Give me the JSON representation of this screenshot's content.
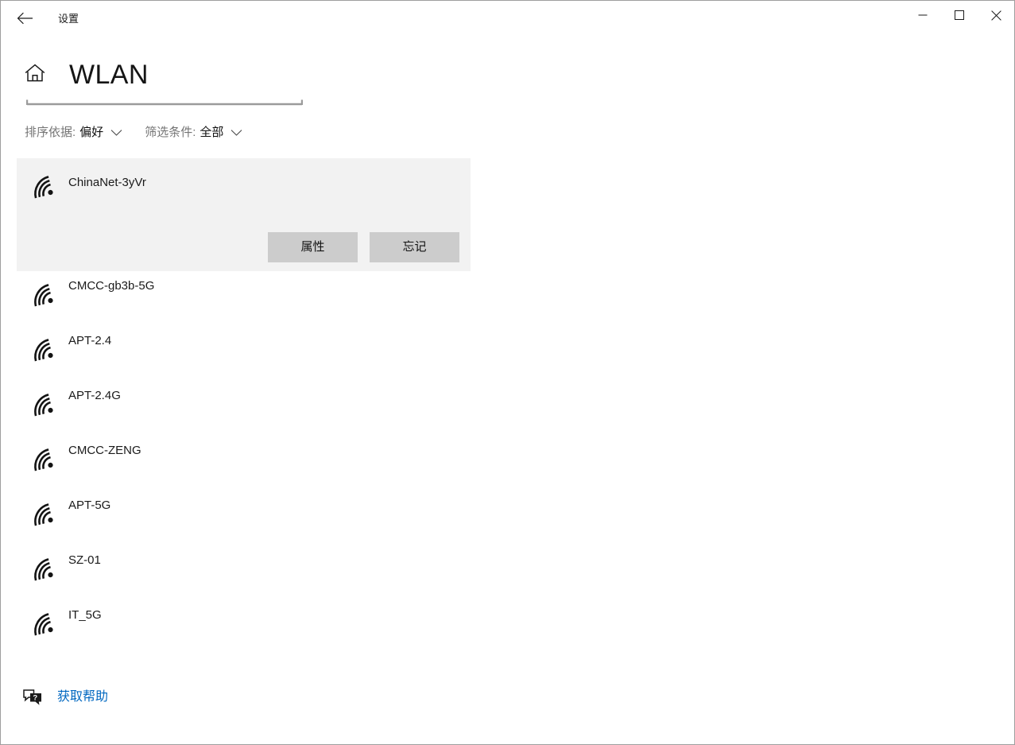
{
  "window": {
    "app_title": "设置",
    "back_icon": "back-arrow-icon",
    "minimize_label": "—",
    "maximize_label": "□",
    "close_label": "✕"
  },
  "page": {
    "home_icon": "home-icon",
    "title": "WLAN"
  },
  "filters": [
    {
      "label": "排序依据:",
      "value": "偏好",
      "icon": "chevron-down-icon",
      "name": "sort-by"
    },
    {
      "label": "筛选条件:",
      "value": "全部",
      "icon": "chevron-down-icon",
      "name": "filter-by"
    }
  ],
  "networks": [
    {
      "ssid": "ChinaNet-3yVr",
      "selected": true,
      "icon": "wifi-signal-full-icon",
      "actions": [
        {
          "label": "属性",
          "name": "properties-button"
        },
        {
          "label": "忘记",
          "name": "forget-button"
        }
      ]
    },
    {
      "ssid": "CMCC-gb3b-5G",
      "selected": false,
      "icon": "wifi-signal-full-icon"
    },
    {
      "ssid": "APT-2.4",
      "selected": false,
      "icon": "wifi-signal-full-icon"
    },
    {
      "ssid": "APT-2.4G",
      "selected": false,
      "icon": "wifi-signal-full-icon"
    },
    {
      "ssid": "CMCC-ZENG",
      "selected": false,
      "icon": "wifi-signal-full-icon"
    },
    {
      "ssid": "APT-5G",
      "selected": false,
      "icon": "wifi-signal-full-icon"
    },
    {
      "ssid": "SZ-01",
      "selected": false,
      "icon": "wifi-signal-full-icon"
    },
    {
      "ssid": "IT_5G",
      "selected": false,
      "icon": "wifi-signal-full-icon"
    }
  ],
  "footer": {
    "help_icon": "help-question-bubble-icon",
    "help_label": "获取帮助",
    "help_color": "#0067c0"
  },
  "colors": {
    "selected_card_bg": "#f2f2f2",
    "button_bg": "#cccccc",
    "window_border": "#9e9e9e",
    "label_gray": "#757575",
    "link_blue": "#0067c0"
  }
}
